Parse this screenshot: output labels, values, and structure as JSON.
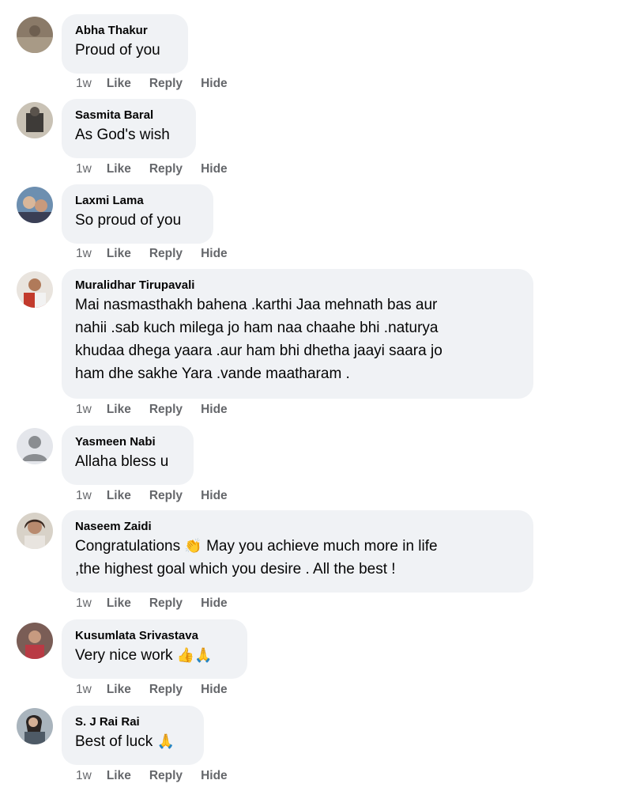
{
  "comments": [
    {
      "author": "Abha Thakur",
      "text": "Proud of you",
      "time": "1w",
      "like": "Like",
      "reply": "Reply",
      "hide": "Hide",
      "avatar_icon": "profile-photo"
    },
    {
      "author": "Sasmita Baral",
      "text": "As God's wish",
      "time": "1w",
      "like": "Like",
      "reply": "Reply",
      "hide": "Hide",
      "avatar_icon": "profile-photo"
    },
    {
      "author": "Laxmi Lama",
      "text": "So proud of you",
      "time": "1w",
      "like": "Like",
      "reply": "Reply",
      "hide": "Hide",
      "avatar_icon": "profile-photo"
    },
    {
      "author": "Muralidhar Tirupavali",
      "text": "Mai nasmasthakh bahena .karthi Jaa mehnath bas aur\nnahii .sab kuch milega jo ham naa chaahe bhi .naturya\nkhudaa dhega yaara .aur ham bhi dhetha jaayi saara jo\nham dhe sakhe Yara .vande maatharam .",
      "time": "1w",
      "like": "Like",
      "reply": "Reply",
      "hide": "Hide",
      "avatar_icon": "profile-photo"
    },
    {
      "author": "Yasmeen Nabi",
      "text": "Allaha bless u",
      "time": "1w",
      "like": "Like",
      "reply": "Reply",
      "hide": "Hide",
      "avatar_icon": "default-avatar-icon"
    },
    {
      "author": "Naseem Zaidi",
      "text_before": "Congratulations ",
      "emoji": "👏",
      "text_after": " May you achieve much more in life\n,the highest goal which you desire . All the best !",
      "time": "1w",
      "like": "Like",
      "reply": "Reply",
      "hide": "Hide",
      "avatar_icon": "profile-photo"
    },
    {
      "author": "Kusumlata Srivastava",
      "text_before": "Very nice work ",
      "emoji": "👍🙏",
      "time": "1w",
      "like": "Like",
      "reply": "Reply",
      "hide": "Hide",
      "avatar_icon": "profile-photo"
    },
    {
      "author": "S. J Rai Rai",
      "text_before": "Best of luck ",
      "emoji": "🙏",
      "time": "1w",
      "like": "Like",
      "reply": "Reply",
      "hide": "Hide",
      "avatar_icon": "profile-photo"
    }
  ],
  "colors": {
    "bubble_bg": "#f0f2f5",
    "meta_text": "#65676b",
    "primary_text": "#050505"
  }
}
